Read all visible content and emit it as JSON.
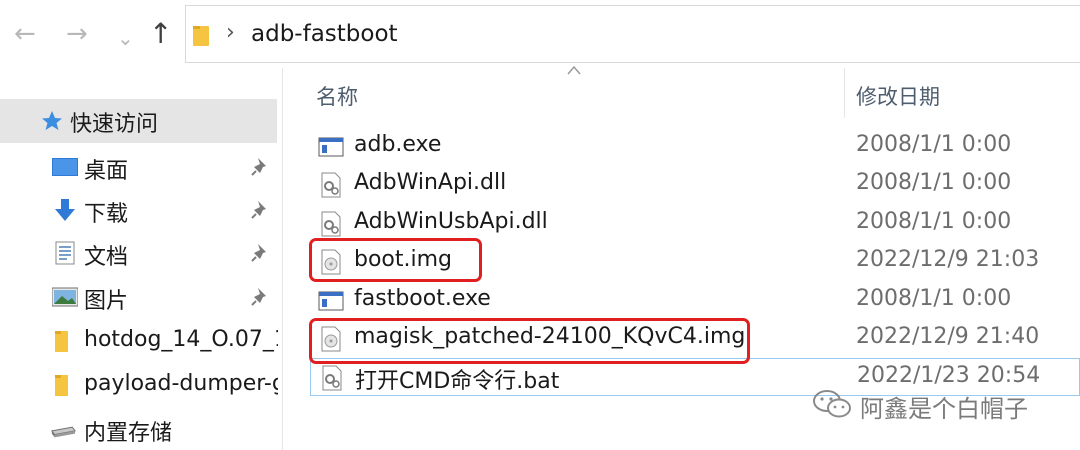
{
  "toolbar": {
    "back_icon": "←",
    "forward_icon": "→",
    "history_icon": "⌄",
    "up_icon": "↑"
  },
  "address": {
    "separator": "›",
    "path": "adb-fastboot"
  },
  "sidebar": {
    "quick_access": "快速访问",
    "items": [
      {
        "label": "桌面",
        "icon": "desktop-icon",
        "pinned": true
      },
      {
        "label": "下载",
        "icon": "download-icon",
        "pinned": true
      },
      {
        "label": "文档",
        "icon": "document-icon",
        "pinned": true
      },
      {
        "label": "图片",
        "icon": "pictures-icon",
        "pinned": true
      },
      {
        "label": "hotdog_14_O.07_1",
        "icon": "folder-icon",
        "pinned": false
      },
      {
        "label": "payload-dumper-g",
        "icon": "folder-icon",
        "pinned": false
      },
      {
        "label": "内置存储",
        "icon": "drive-icon",
        "pinned": false
      }
    ]
  },
  "list": {
    "columns": {
      "name": "名称",
      "date": "修改日期"
    },
    "files": [
      {
        "name": "adb.exe",
        "date": "2008/1/1 0:00",
        "icon": "exe-icon"
      },
      {
        "name": "AdbWinApi.dll",
        "date": "2008/1/1 0:00",
        "icon": "dll-icon"
      },
      {
        "name": "AdbWinUsbApi.dll",
        "date": "2008/1/1 0:00",
        "icon": "dll-icon"
      },
      {
        "name": "boot.img",
        "date": "2022/12/9 21:03",
        "icon": "disc-image-icon"
      },
      {
        "name": "fastboot.exe",
        "date": "2008/1/1 0:00",
        "icon": "exe-icon"
      },
      {
        "name": "magisk_patched-24100_KQvC4.img",
        "date": "2022/12/9 21:40",
        "icon": "disc-image-icon"
      },
      {
        "name": "打开CMD命令行.bat",
        "date": "2022/1/23 20:54",
        "icon": "bat-icon"
      }
    ]
  },
  "watermark": {
    "text": "阿鑫是个白帽子",
    "icon": "wechat-icon"
  },
  "colors": {
    "highlight": "#e02020",
    "selection_bg": "#e5e5e5",
    "accent": "#2f7ad6"
  }
}
